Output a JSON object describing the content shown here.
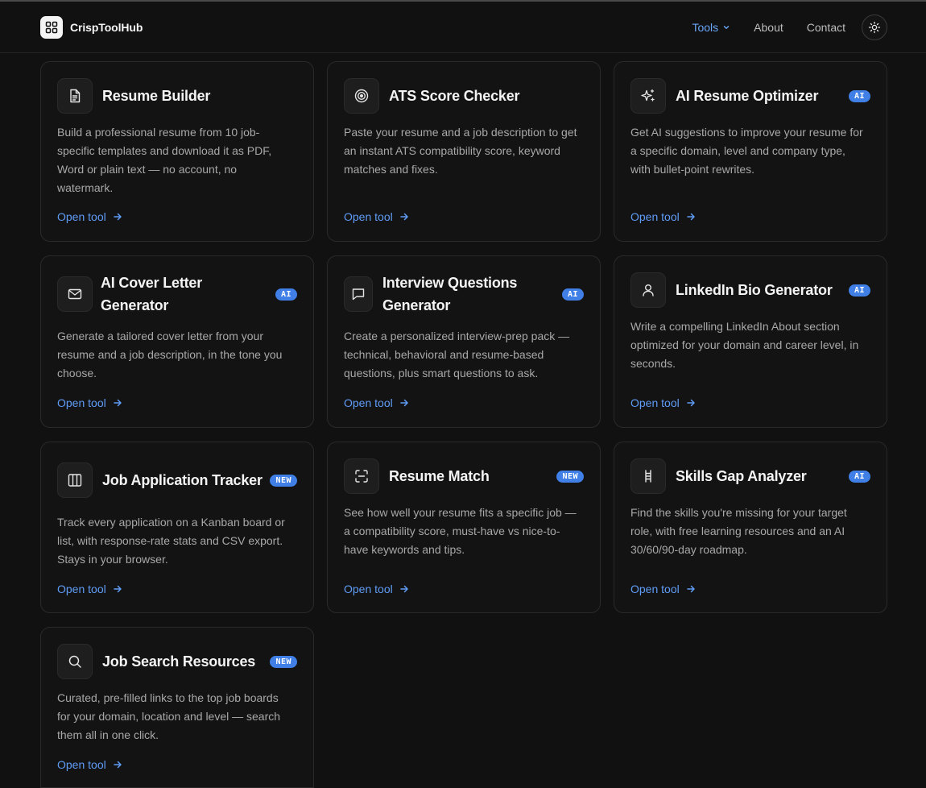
{
  "brand": {
    "name": "CrispToolHub"
  },
  "nav": {
    "tools": "Tools",
    "about": "About",
    "contact": "Contact"
  },
  "colors": {
    "accent": "#5f9cf6",
    "badge": "#3f7fe6",
    "background": "#111111",
    "card": "#131313"
  },
  "cards": [
    {
      "icon": "document-icon",
      "title": "Resume Builder",
      "badge": "",
      "desc": "Build a professional resume from 10 job-specific templates and download it as PDF, Word or plain text — no account, no watermark.",
      "link": "Open tool"
    },
    {
      "icon": "target-icon",
      "title": "ATS Score Checker",
      "badge": "",
      "desc": "Paste your resume and a job description to get an instant ATS compatibility score, keyword matches and fixes.",
      "link": "Open tool"
    },
    {
      "icon": "sparkles-icon",
      "title": "AI Resume Optimizer",
      "badge": "AI",
      "desc": "Get AI suggestions to improve your resume for a specific domain, level and company type, with bullet-point rewrites.",
      "link": "Open tool"
    },
    {
      "icon": "mail-icon",
      "title": "AI Cover Letter Generator",
      "badge": "AI",
      "desc": "Generate a tailored cover letter from your resume and a job description, in the tone you choose.",
      "link": "Open tool"
    },
    {
      "icon": "chat-icon",
      "title": "Interview Questions Generator",
      "badge": "AI",
      "desc": "Create a personalized interview-prep pack — technical, behavioral and resume-based questions, plus smart questions to ask.",
      "link": "Open tool"
    },
    {
      "icon": "user-icon",
      "title": "LinkedIn Bio Generator",
      "badge": "AI",
      "desc": "Write a compelling LinkedIn About section optimized for your domain and career level, in seconds.",
      "link": "Open tool"
    },
    {
      "icon": "columns-icon",
      "title": "Job Application Tracker",
      "badge": "NEW",
      "desc": "Track every application on a Kanban board or list, with response-rate stats and CSV export. Stays in your browser.",
      "link": "Open tool"
    },
    {
      "icon": "scan-icon",
      "title": "Resume Match",
      "badge": "NEW",
      "desc": "See how well your resume fits a specific job — a compatibility score, must-have vs nice-to-have keywords and tips.",
      "link": "Open tool"
    },
    {
      "icon": "ladder-icon",
      "title": "Skills Gap Analyzer",
      "badge": "AI",
      "desc": "Find the skills you're missing for your target role, with free learning resources and an AI 30/60/90-day roadmap.",
      "link": "Open tool"
    },
    {
      "icon": "search-icon",
      "title": "Job Search Resources",
      "badge": "NEW",
      "desc": "Curated, pre-filled links to the top job boards for your domain, location and level — search them all in one click.",
      "link": "Open tool"
    }
  ]
}
